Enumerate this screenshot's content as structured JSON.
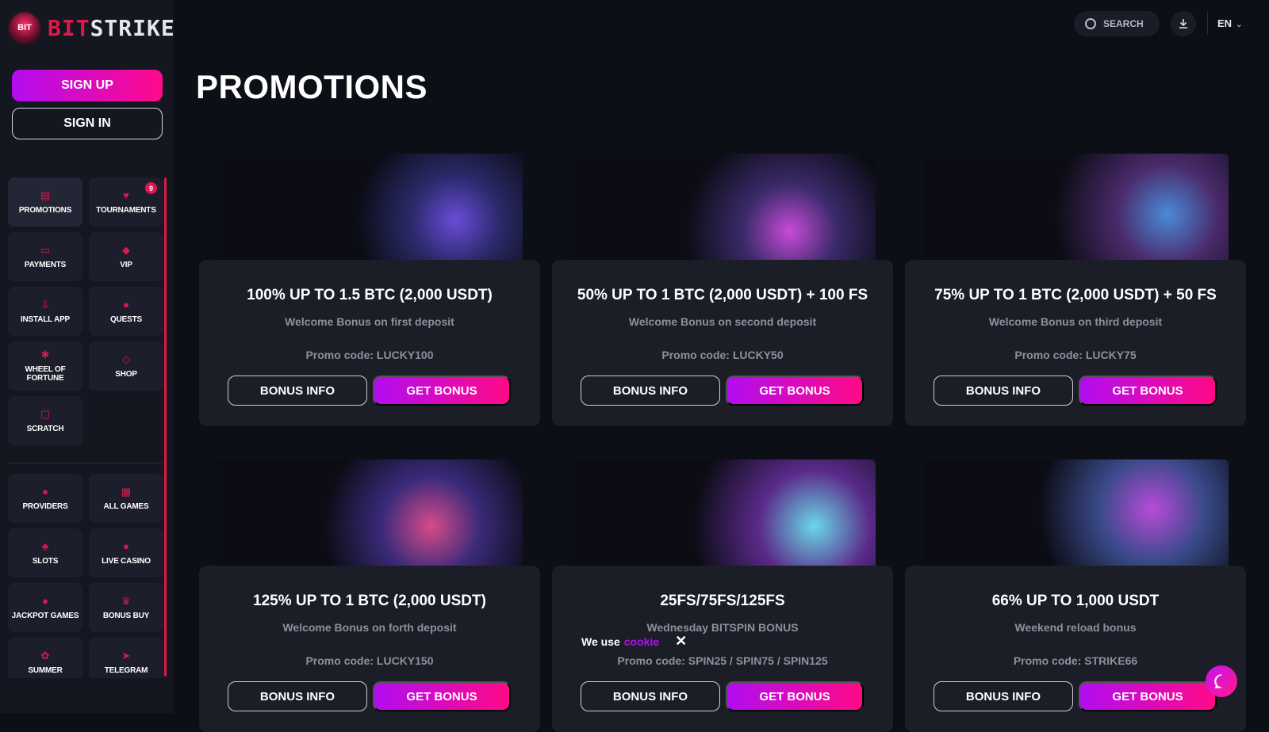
{
  "brand": {
    "badge": "BIT",
    "name_part1": "BIT",
    "name_part2": "STRIKE"
  },
  "auth": {
    "signup": "SIGN UP",
    "signin": "SIGN IN"
  },
  "nav": {
    "group1": [
      {
        "label": "PROMOTIONS",
        "icon": "gift-icon",
        "active": true
      },
      {
        "label": "TOURNAMENTS",
        "icon": "trophy-icon",
        "badge": "9"
      },
      {
        "label": "PAYMENTS",
        "icon": "wallet-icon"
      },
      {
        "label": "VIP",
        "icon": "diamond-icon"
      },
      {
        "label": "INSTALL APP",
        "icon": "download-icon"
      },
      {
        "label": "QUESTS",
        "icon": "quest-icon"
      },
      {
        "label": "WHEEL OF FORTUNE",
        "icon": "wheel-icon"
      },
      {
        "label": "SHOP",
        "icon": "tag-icon"
      },
      {
        "label": "SCRATCH",
        "icon": "scratch-icon"
      }
    ],
    "group2": [
      {
        "label": "PROVIDERS",
        "icon": "providers-icon"
      },
      {
        "label": "ALL GAMES",
        "icon": "grid-icon"
      },
      {
        "label": "SLOTS",
        "icon": "cherry-icon"
      },
      {
        "label": "LIVE CASINO",
        "icon": "chip-icon"
      },
      {
        "label": "JACKPOT GAMES",
        "icon": "jackpot-icon"
      },
      {
        "label": "BONUS BUY",
        "icon": "crown-icon"
      },
      {
        "label": "SUMMER",
        "icon": "summer-icon"
      },
      {
        "label": "TELEGRAM",
        "icon": "telegram-icon"
      }
    ]
  },
  "topbar": {
    "search": "SEARCH",
    "lang": "EN"
  },
  "page": {
    "title": "PROMOTIONS"
  },
  "promos": [
    {
      "title": "100% UP TO 1.5 BTC (2,000 USDT)",
      "sub": "Welcome Bonus on first deposit",
      "promo": "Promo code: LUCKY100",
      "info": "BONUS INFO",
      "get": "GET BONUS"
    },
    {
      "title": "50% UP TO 1 BTC (2,000 USDT) + 100 FS",
      "sub": "Welcome Bonus on second deposit",
      "promo": "Promo code: LUCKY50",
      "info": "BONUS INFO",
      "get": "GET BONUS"
    },
    {
      "title": "75% UP TO 1 BTC (2,000 USDT) + 50 FS",
      "sub": "Welcome Bonus on third deposit",
      "promo": "Promo code: LUCKY75",
      "info": "BONUS INFO",
      "get": "GET BONUS"
    },
    {
      "title": "125% UP TO 1 BTC (2,000 USDT)",
      "sub": "Welcome Bonus on forth deposit",
      "promo": "Promo code: LUCKY150",
      "info": "BONUS INFO",
      "get": "GET BONUS"
    },
    {
      "title": "25FS/75FS/125FS",
      "sub": "Wednesday BITSPIN BONUS",
      "promo": "Promo code: SPIN25 / SPIN75 / SPIN125",
      "info": "BONUS INFO",
      "get": "GET BONUS"
    },
    {
      "title": "66% UP TO 1,000 USDT",
      "sub": "Weekend reload bonus",
      "promo": "Promo code: STRIKE66",
      "info": "BONUS INFO",
      "get": "GET BONUS"
    }
  ],
  "cookie": {
    "text": "We use",
    "link": "cookie"
  },
  "colors": {
    "accent": "#e01749",
    "gradient_start": "#b20cf2",
    "gradient_end": "#ff0a86",
    "bg": "#0d0f17",
    "card": "#1b1d27"
  }
}
